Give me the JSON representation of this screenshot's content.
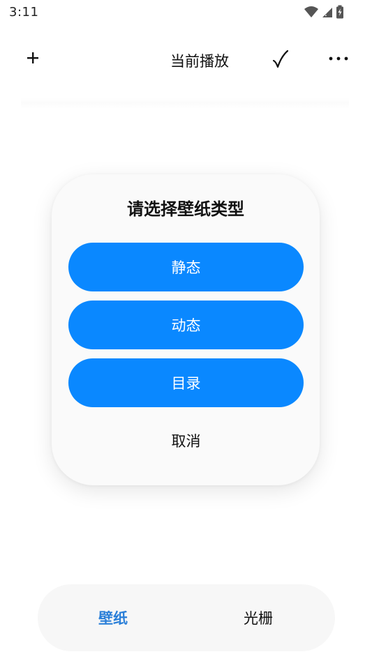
{
  "status_bar": {
    "time": "3:11",
    "icons": [
      "wifi-icon",
      "cell-signal-icon",
      "battery-charging-icon"
    ]
  },
  "toolbar": {
    "add_icon": "plus-icon",
    "title": "当前播放",
    "confirm_icon": "check-icon",
    "more_icon": "more-icon"
  },
  "dialog": {
    "title": "请选择壁纸类型",
    "options": [
      {
        "label": "静态"
      },
      {
        "label": "动态"
      },
      {
        "label": "目录"
      }
    ],
    "cancel_label": "取消"
  },
  "bottom_nav": {
    "items": [
      {
        "label": "壁纸",
        "active": true
      },
      {
        "label": "光栅",
        "active": false
      }
    ]
  },
  "colors": {
    "accent": "#0a88ff",
    "active_tab": "#2a7fd8",
    "dialog_bg": "#fafafa",
    "nav_bg": "#f7f7f7"
  }
}
